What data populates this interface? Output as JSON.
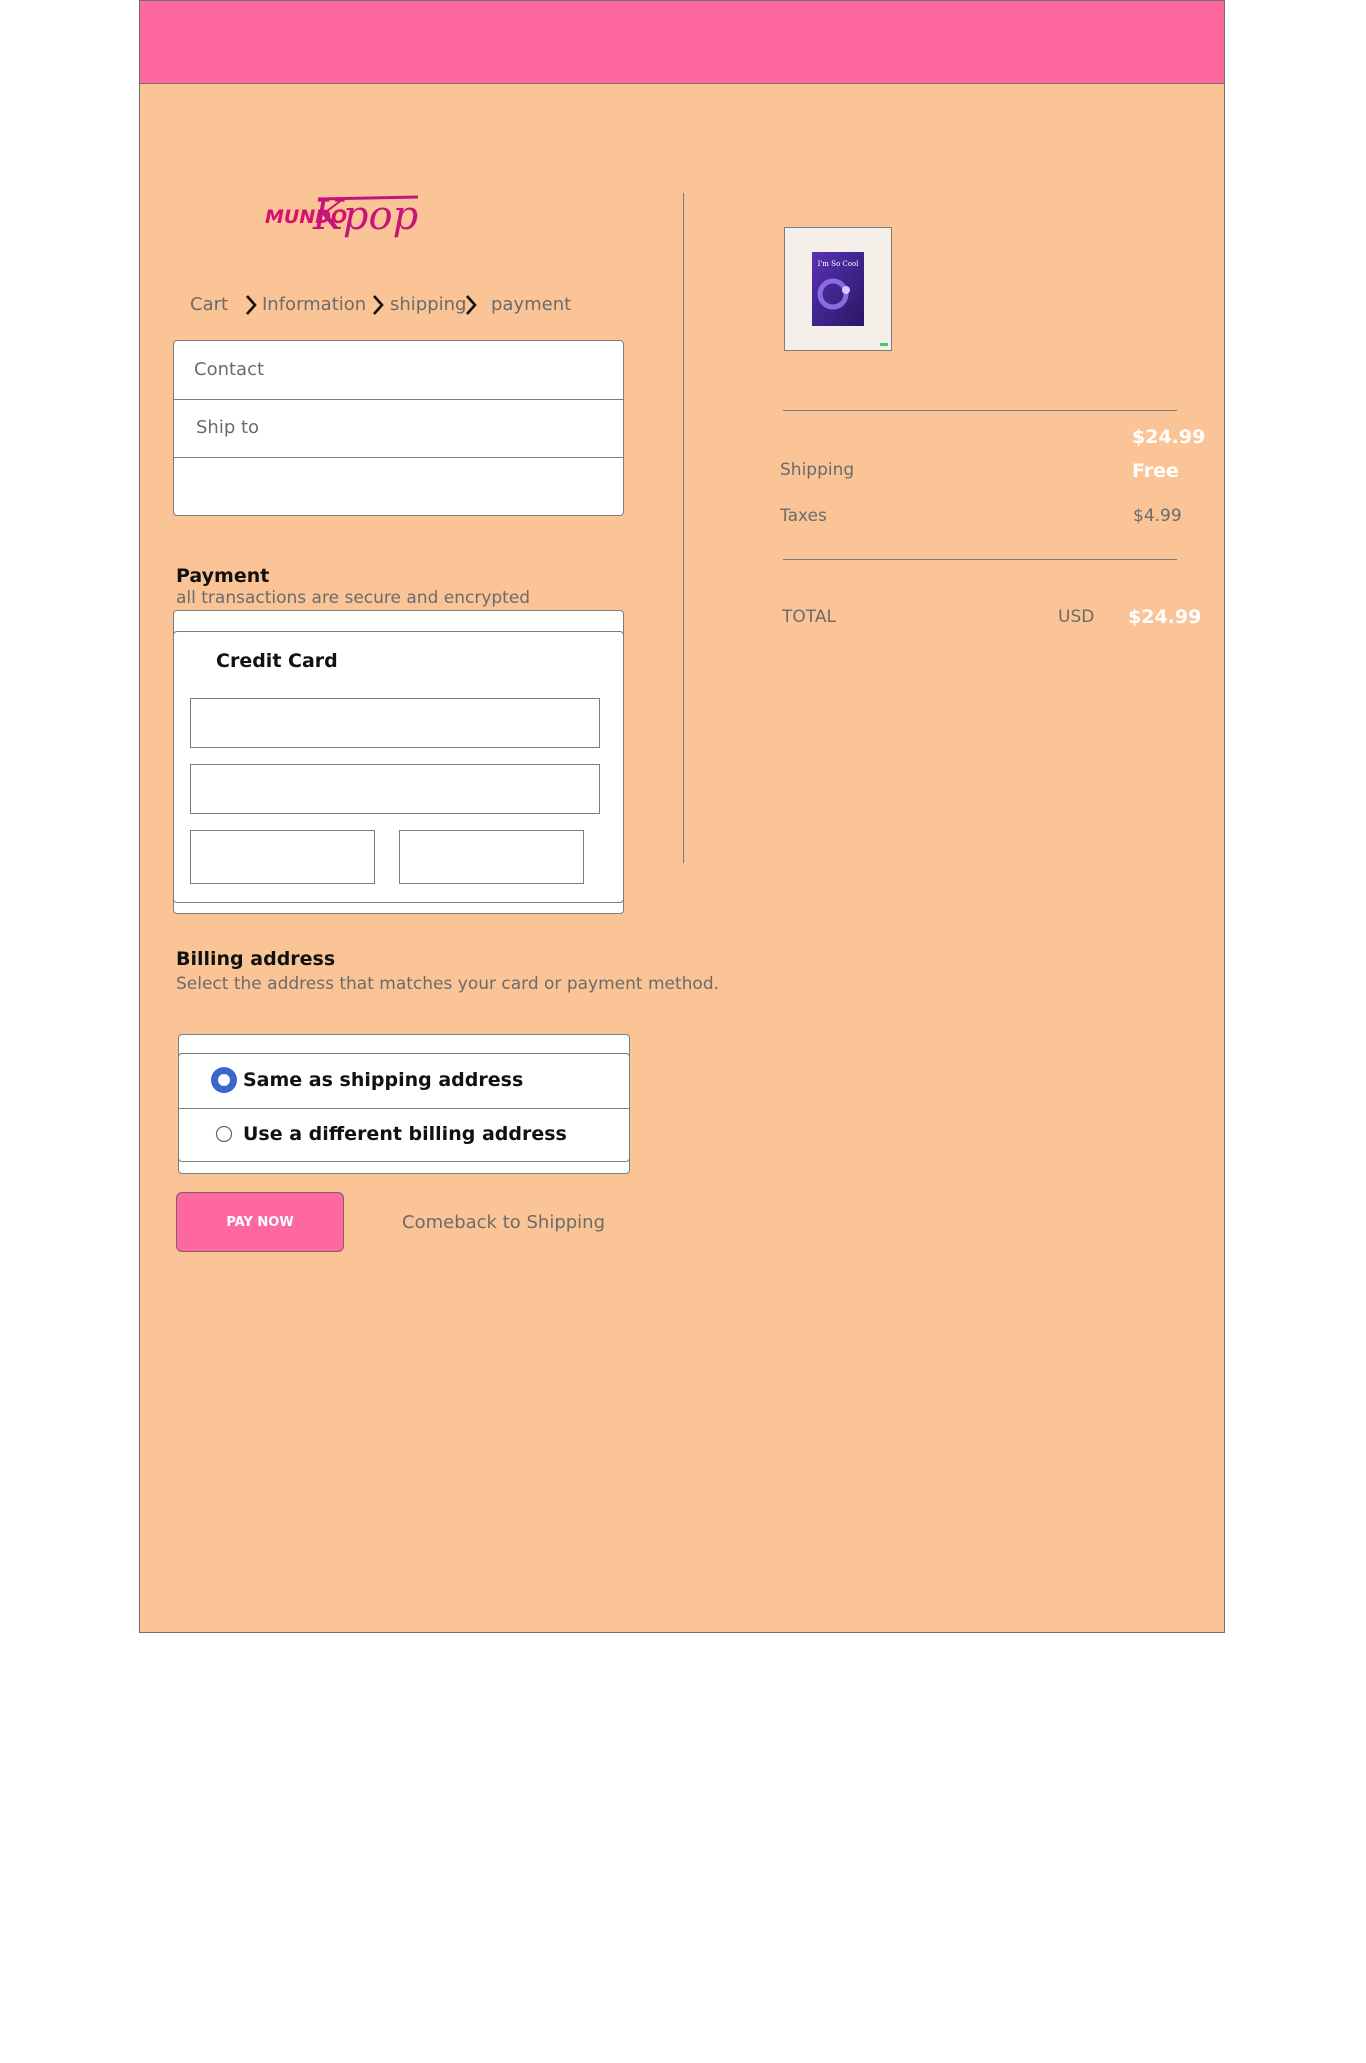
{
  "brand": {
    "logo_word1": "MUNDO",
    "logo_word2": "Kpop",
    "brand_pink": "#fd689f",
    "background_peach": "#fbc497"
  },
  "breadcrumb": {
    "items": [
      "Cart",
      "Information",
      "shipping",
      "payment"
    ]
  },
  "summary_box": {
    "contact_label": "Contact",
    "ship_to_label": "Ship to"
  },
  "payment": {
    "title": "Payment",
    "subtitle": "all transactions are secure and encrypted",
    "method_label": "Credit Card"
  },
  "billing": {
    "title": "Billing address",
    "subtitle": "Select the address that matches your card or payment method.",
    "options": [
      {
        "label": "Same as shipping address",
        "selected": true
      },
      {
        "label": "Use a different billing address",
        "selected": false
      }
    ]
  },
  "actions": {
    "pay_now": "PAY NOW",
    "back_link": "Comeback to Shipping"
  },
  "order": {
    "product_image_text": "I'm So Cool",
    "subtotal_value": "$24.99",
    "shipping_label": "Shipping",
    "shipping_value": "Free",
    "taxes_label": "Taxes",
    "taxes_value": "$4.99",
    "total_label": "TOTAL",
    "currency": "USD",
    "total_value": "$24.99"
  }
}
